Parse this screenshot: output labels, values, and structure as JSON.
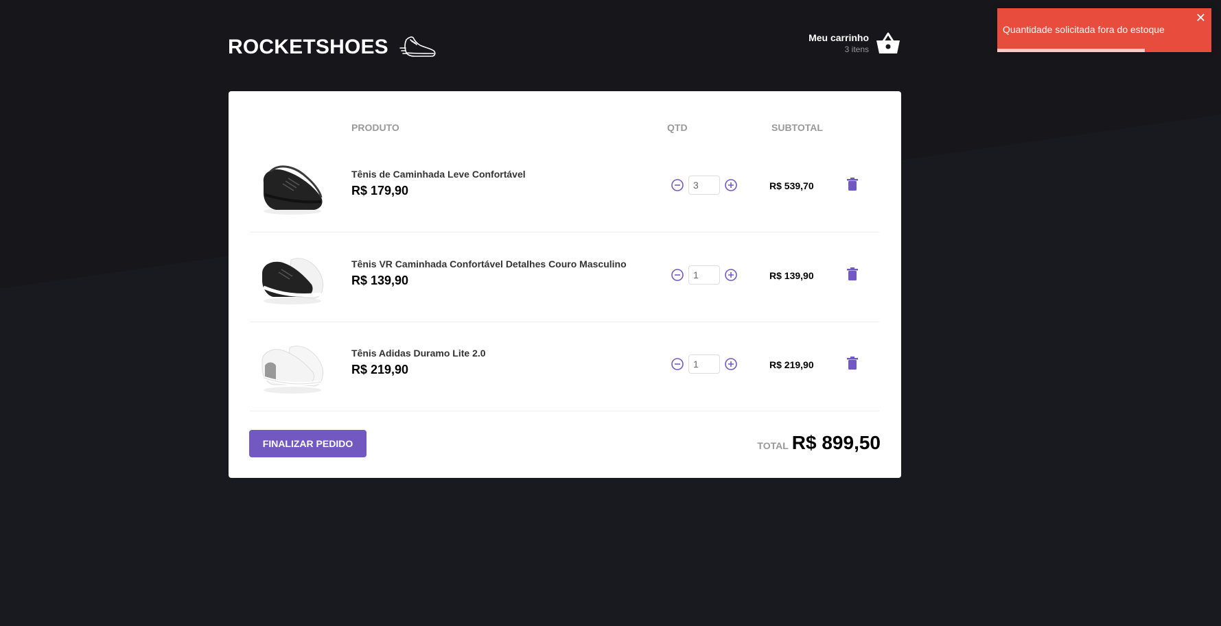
{
  "header": {
    "logo_text": "ROCKETSHOES",
    "cart_title": "Meu carrinho",
    "cart_count": "3 itens"
  },
  "table": {
    "columns": [
      "PRODUTO",
      "QTD",
      "SUBTOTAL"
    ]
  },
  "items": [
    {
      "name": "Tênis de Caminhada Leve Confortável",
      "price": "R$ 179,90",
      "quantity": "3",
      "subtotal": "R$ 539,70",
      "image": "black-shoe"
    },
    {
      "name": "Tênis VR Caminhada Confortável Detalhes Couro Masculino",
      "price": "R$ 139,90",
      "quantity": "1",
      "subtotal": "R$ 139,90",
      "image": "black-white-shoe"
    },
    {
      "name": "Tênis Adidas Duramo Lite 2.0",
      "price": "R$ 219,90",
      "quantity": "1",
      "subtotal": "R$ 219,90",
      "image": "white-shoe"
    }
  ],
  "footer": {
    "checkout_label": "FINALIZAR PEDIDO",
    "total_label": "TOTAL",
    "total_value": "R$ 899,50"
  },
  "toast": {
    "message": "Quantidade solicitada fora do estoque",
    "close_label": "✕",
    "progress_remaining": 0.69
  },
  "colors": {
    "background": "#191920",
    "accent": "#7159c1",
    "toast": "#e74c3c",
    "card": "#ffffff"
  },
  "icons": [
    "running-shoe-logo-icon",
    "basket-icon",
    "minus-circle-icon",
    "plus-circle-icon",
    "trash-icon",
    "close-icon"
  ]
}
